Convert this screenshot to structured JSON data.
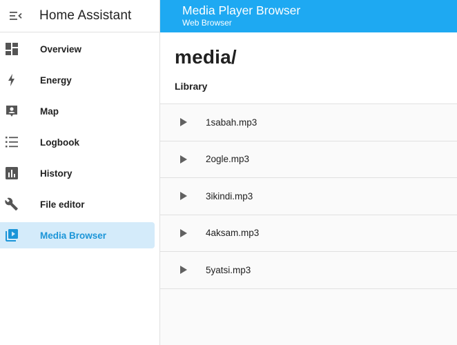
{
  "app": {
    "title": "Home Assistant"
  },
  "sidebar": {
    "items": [
      {
        "label": "Overview",
        "icon": "view-dashboard-icon"
      },
      {
        "label": "Energy",
        "icon": "lightning-bolt-icon"
      },
      {
        "label": "Map",
        "icon": "account-box-icon"
      },
      {
        "label": "Logbook",
        "icon": "format-list-bulleted-icon"
      },
      {
        "label": "History",
        "icon": "chart-box-icon"
      },
      {
        "label": "File editor",
        "icon": "wrench-icon"
      },
      {
        "label": "Media Browser",
        "icon": "play-box-multiple-icon",
        "active": true
      }
    ]
  },
  "topbar": {
    "title": "Media Player Browser",
    "subtitle": "Web Browser"
  },
  "browser": {
    "path": "media/",
    "section": "Library",
    "files": [
      "1sabah.mp3",
      "2ogle.mp3",
      "3ikindi.mp3",
      "4aksam.mp3",
      "5yatsi.mp3"
    ]
  },
  "colors": {
    "accent": "#1ea9f2",
    "active_bg": "#d4ebfa",
    "active_text": "#1b95d8",
    "icon": "#555555"
  }
}
